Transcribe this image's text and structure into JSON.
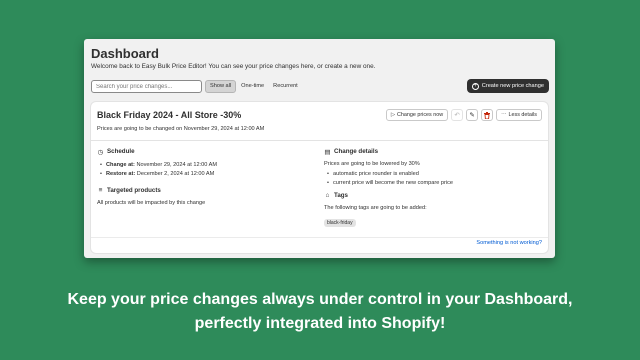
{
  "header": {
    "title": "Dashboard",
    "welcome": "Welcome back to Easy Bulk Price Editor! You can see your price changes here, or create a new one."
  },
  "toolbar": {
    "search_placeholder": "Search your price changes...",
    "filters": [
      "Show all",
      "One-time",
      "Recurrent"
    ],
    "active_filter": "Show all",
    "create_label": "Create new price change"
  },
  "card": {
    "title": "Black Friday 2024 - All Store -30%",
    "subtitle": "Prices are going to be changed on November 29, 2024 at 12:00 AM",
    "actions": {
      "change_prices_label": "Change prices now",
      "less_details_label": "Less details"
    },
    "schedule": {
      "heading": "Schedule",
      "change_at_label": "Change at:",
      "change_at_value": "November 29, 2024 at 12:00 AM",
      "restore_at_label": "Restore at:",
      "restore_at_value": "December 2, 2024 at 12:00 AM"
    },
    "targeted": {
      "heading": "Targeted products",
      "text": "All products will be impacted by this change"
    },
    "change_details": {
      "heading": "Change details",
      "text": "Prices are going to be lowered by 30%",
      "bullets": [
        "automatic price rounder is enabled",
        "current price will become the new compare price"
      ]
    },
    "tags": {
      "heading": "Tags",
      "text": "The following tags are going to be added:",
      "items": [
        "black-friday"
      ]
    },
    "help_link": "Something is not working?"
  },
  "caption": {
    "line1": "Keep your price changes always under control in your Dashboard,",
    "line2": "perfectly integrated into Shopify!"
  },
  "colors": {
    "background": "#2e8b5a",
    "primary_button": "#303030",
    "link": "#005bd3",
    "danger": "#c5280c"
  }
}
